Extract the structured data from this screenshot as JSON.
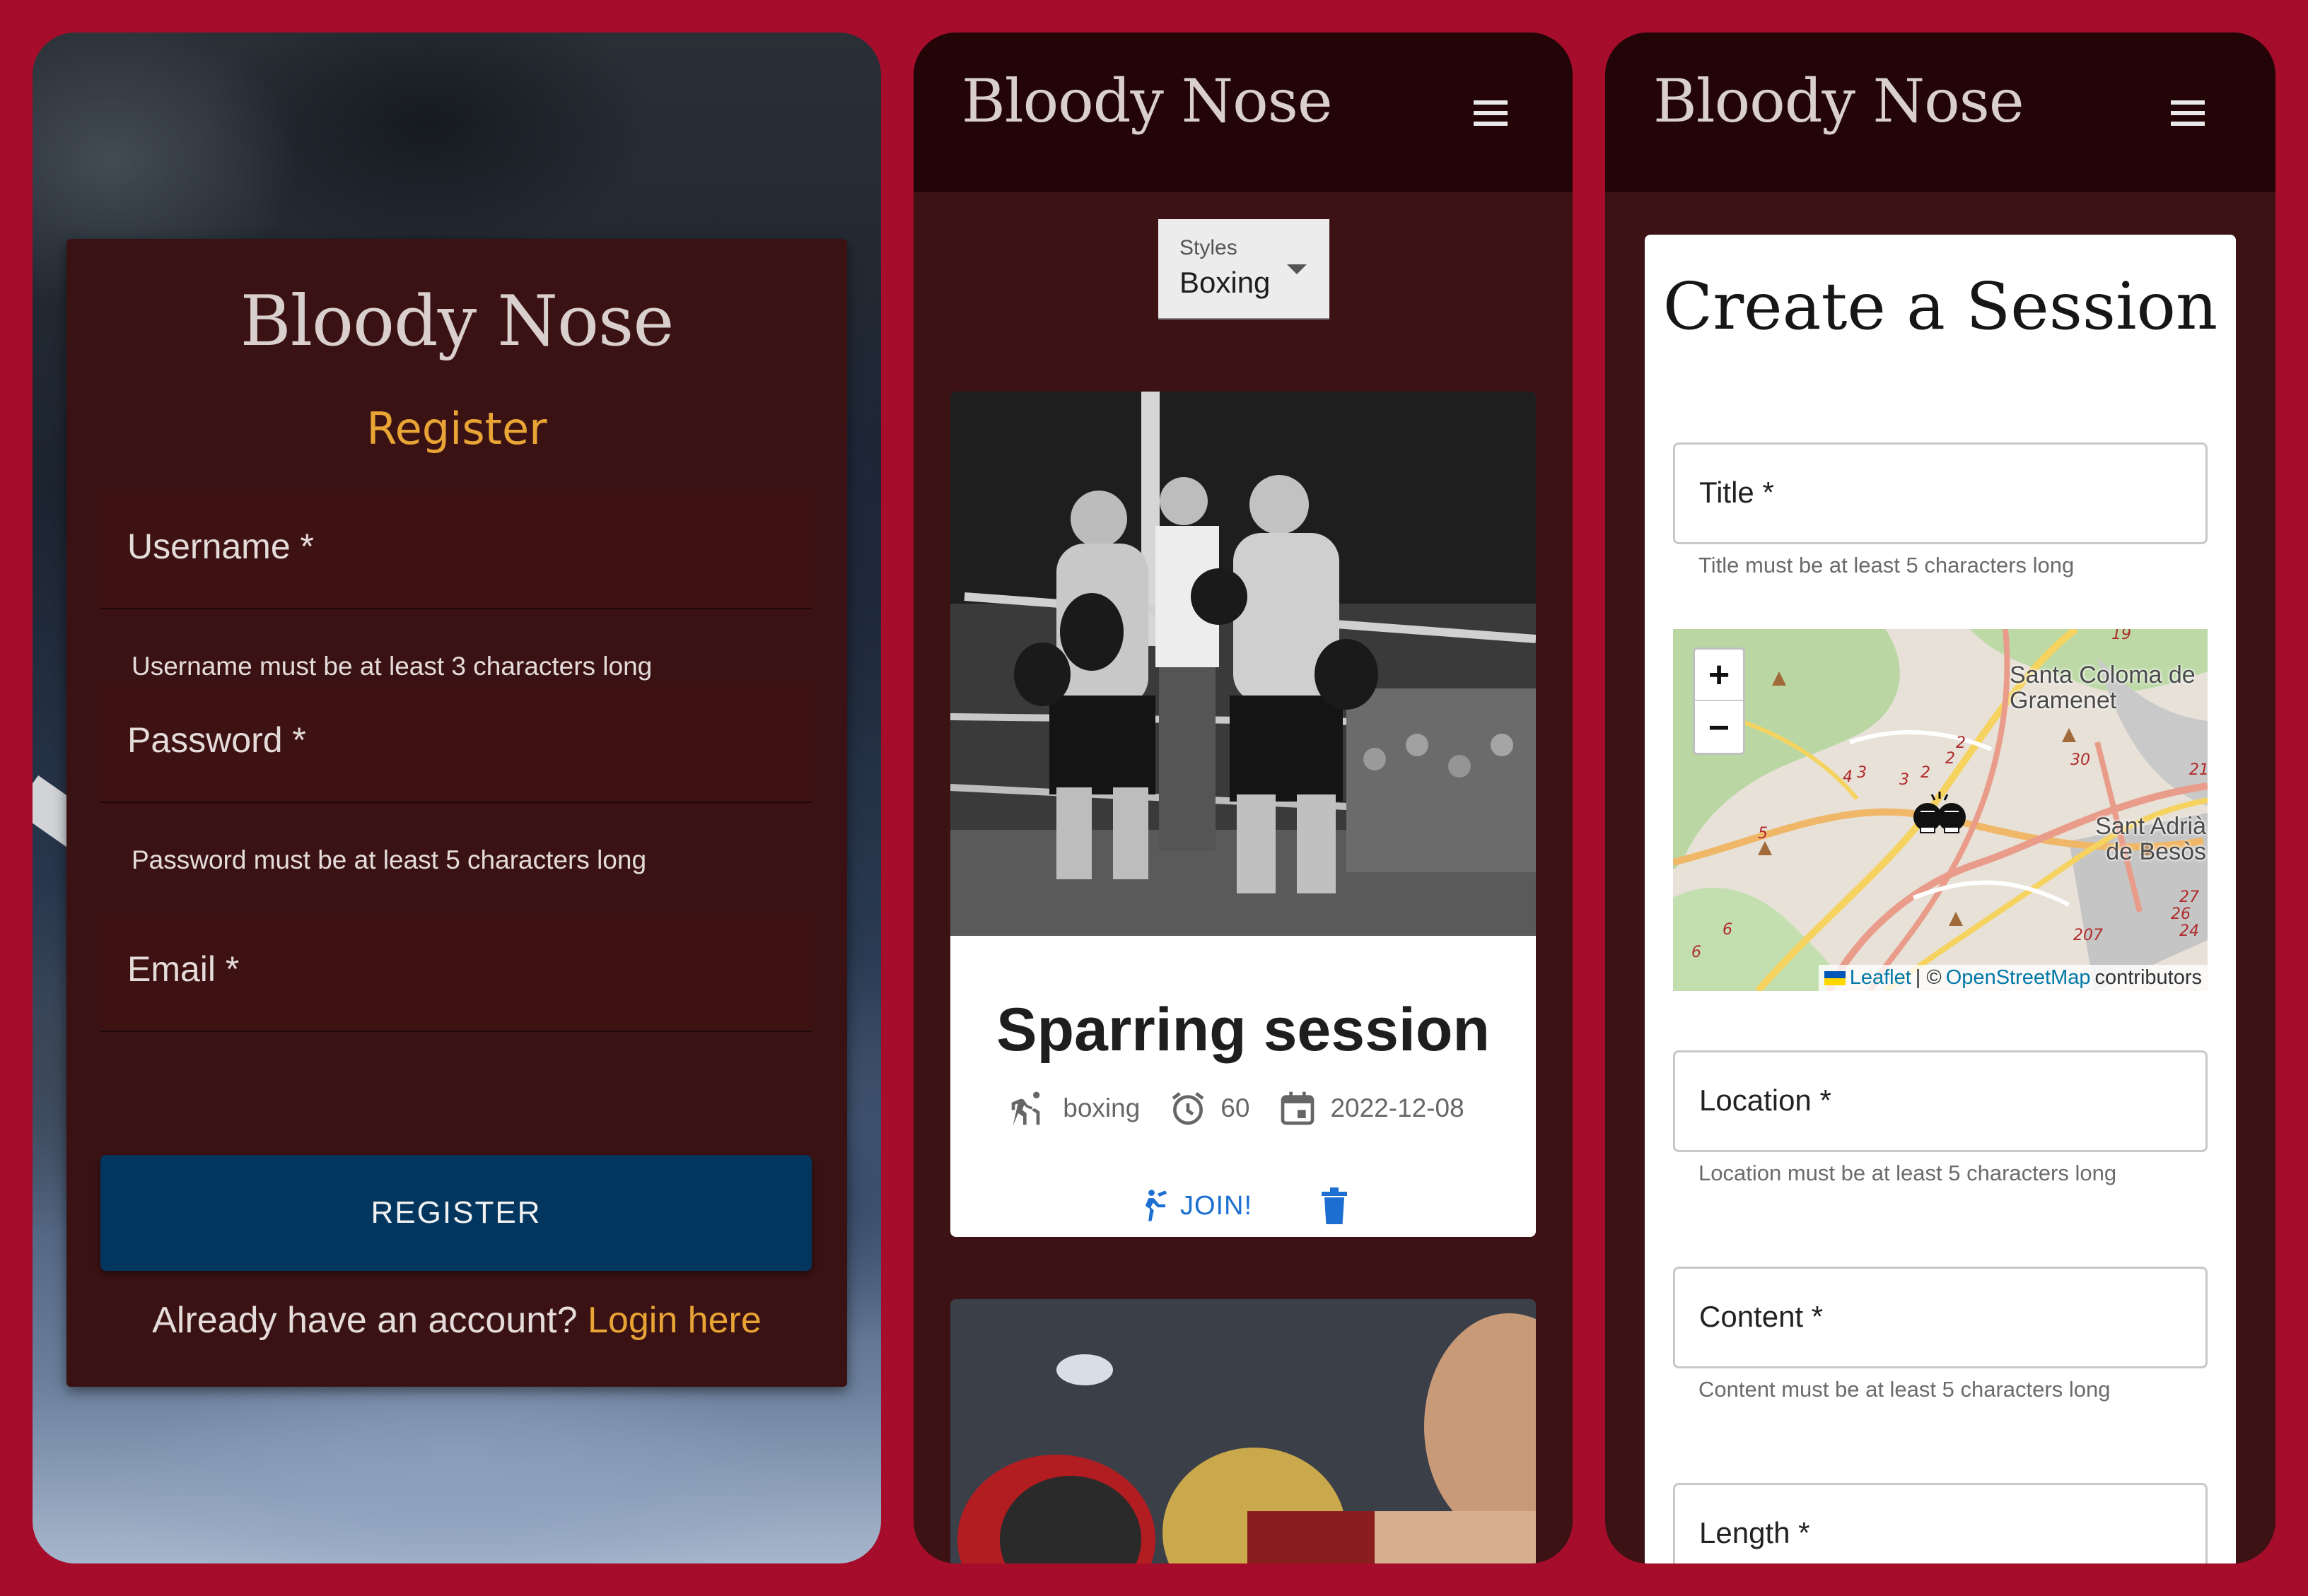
{
  "register_screen": {
    "brand": "Bloody Nose",
    "subtitle": "Register",
    "fields": {
      "username": {
        "label": "Username *",
        "helper": "Username must be at least 3 characters long"
      },
      "password": {
        "label": "Password *",
        "helper": "Password must be at least 5 characters long"
      },
      "email": {
        "label": "Email *"
      }
    },
    "register_button": "REGISTER",
    "login_prompt": "Already have an account?",
    "login_link": "Login here"
  },
  "sessions_screen": {
    "brand": "Bloody Nose",
    "styles_filter": {
      "label": "Styles",
      "value": "Boxing"
    },
    "session_card": {
      "title": "Sparring session",
      "style": "boxing",
      "duration": "60",
      "date": "2022-12-08",
      "join_label": "JOIN!"
    }
  },
  "create_screen": {
    "brand": "Bloody Nose",
    "title": "Create a Session",
    "fields": {
      "title": {
        "label": "Title *",
        "helper": "Title must be at least 5 characters long"
      },
      "location": {
        "label": "Location *",
        "helper": "Location must be at least 5 characters long"
      },
      "content": {
        "label": "Content *",
        "helper": "Content must be at least 5 characters long"
      },
      "length": {
        "label": "Length *"
      }
    },
    "map": {
      "zoom_in": "+",
      "zoom_out": "−",
      "place_labels": [
        "Santa Coloma de Gramenet",
        "Sant Adrià de Besòs"
      ],
      "road_numbers": [
        "19",
        "2",
        "2",
        "2",
        "3",
        "3",
        "4",
        "30",
        "21",
        "5",
        "27",
        "26",
        "24",
        "207",
        "6",
        "6"
      ],
      "attribution": {
        "leaflet": "Leaflet",
        "separator": "| ©",
        "osm": "OpenStreetMap",
        "suffix": "contributors"
      }
    }
  },
  "colors": {
    "page_background": "#a50d2b",
    "app_bar": "#240507",
    "screen_background": "#3c1214",
    "accent_orange": "#e8a434",
    "primary_button": "#03365e",
    "link_blue": "#1c6fd0"
  },
  "icons": [
    "menu-icon",
    "martial-arts-icon",
    "alarm-clock-icon",
    "calendar-icon",
    "kick-icon",
    "trash-icon",
    "boxing-gloves-marker-icon",
    "ukraine-flag-icon"
  ]
}
